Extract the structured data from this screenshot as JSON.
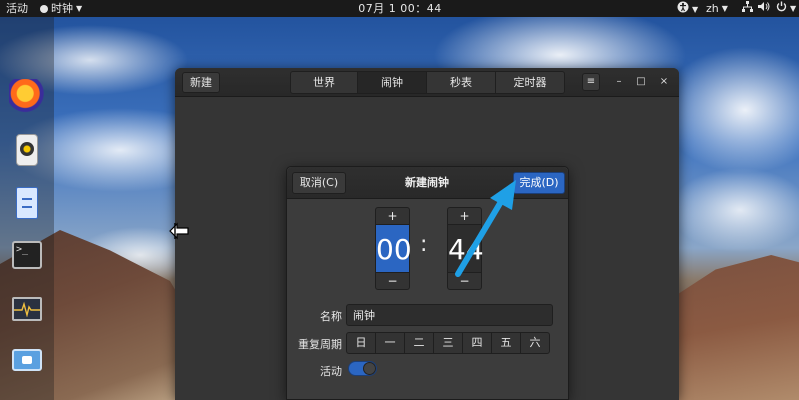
{
  "top_bar": {
    "activities": "活动",
    "clock_menu": "时钟",
    "time": "07月 1 00：44",
    "language": "zh"
  },
  "dock": {
    "items": [
      "firefox-icon",
      "rhythmbox-icon",
      "files-icon",
      "terminal-icon",
      "system-monitor-icon",
      "screenshot-icon"
    ],
    "terminal_glyph": ">_"
  },
  "window": {
    "new_label": "新建",
    "tabs": [
      {
        "label": "世界"
      },
      {
        "label": "闹钟",
        "selected": true
      },
      {
        "label": "秒表"
      },
      {
        "label": "定时器"
      }
    ],
    "menu_glyph": "≡",
    "minimize_glyph": "–",
    "maximize_glyph": "□",
    "close_glyph": "×"
  },
  "dialog": {
    "cancel_label": "取消(C)",
    "title": "新建闹钟",
    "done_label": "完成(D)",
    "hour": "00",
    "minute": "44",
    "colon": ":",
    "plus": "+",
    "minus": "−",
    "name_label": "名称",
    "name_value": "闹钟",
    "repeat_label": "重复周期",
    "days": [
      "日",
      "一",
      "二",
      "三",
      "四",
      "五",
      "六"
    ],
    "active_label": "活动",
    "active_on": true
  },
  "colors": {
    "accent": "#2b66c2",
    "arrow": "#1fa0e6"
  }
}
